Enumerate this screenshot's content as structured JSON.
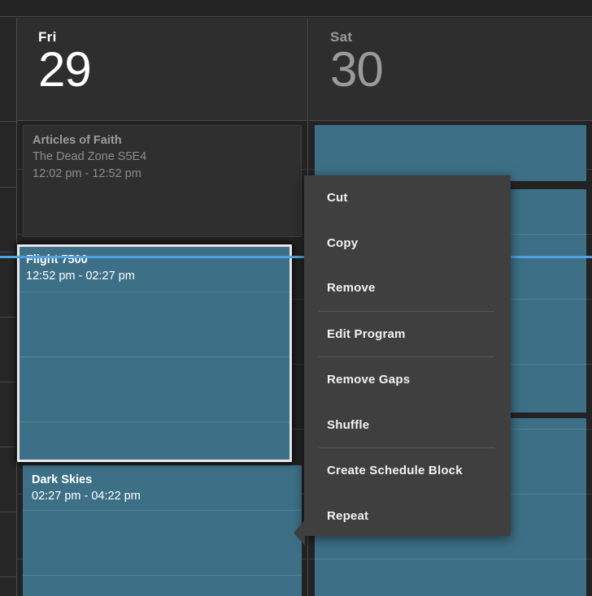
{
  "calendar": {
    "days": [
      {
        "id": "fri",
        "dow": "Fri",
        "date": "29",
        "active": true
      },
      {
        "id": "sat",
        "dow": "Sat",
        "date": "30",
        "active": false
      }
    ],
    "now_line_color": "#4ea3e0",
    "accent_teal": "#3d7087",
    "selection_color": "#e8e8e8"
  },
  "friday_events": [
    {
      "title": "Articles of Faith",
      "subtitle": "The Dead Zone S5E4",
      "time": "12:02 pm - 12:52 pm",
      "state": "past"
    },
    {
      "title": "Flight 7500",
      "subtitle": "",
      "time": "12:52 pm - 02:27 pm",
      "state": "selected"
    },
    {
      "title": "Dark Skies",
      "subtitle": "",
      "time": "02:27 pm - 04:22 pm",
      "state": "scheduled"
    }
  ],
  "saturday_events": [
    {
      "title": "",
      "subtitle": "",
      "time": "",
      "state": "scheduled"
    },
    {
      "title": "",
      "subtitle": "",
      "time": "",
      "state": "scheduled"
    },
    {
      "title": "",
      "subtitle": "",
      "time": "",
      "state": "scheduled"
    }
  ],
  "context_menu": {
    "groups": [
      {
        "items": [
          {
            "label": "Cut"
          },
          {
            "label": "Copy"
          },
          {
            "label": "Remove"
          }
        ]
      },
      {
        "items": [
          {
            "label": "Edit Program"
          }
        ]
      },
      {
        "items": [
          {
            "label": "Remove Gaps"
          },
          {
            "label": "Shuffle"
          }
        ]
      },
      {
        "items": [
          {
            "label": "Create Schedule Block"
          },
          {
            "label": "Repeat"
          }
        ]
      }
    ]
  }
}
